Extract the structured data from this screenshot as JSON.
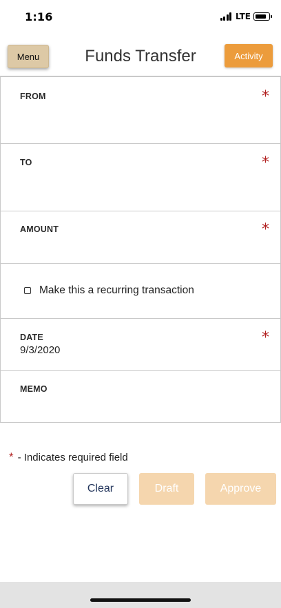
{
  "status_bar": {
    "time": "1:16",
    "network": "LTE",
    "icons": [
      "signal-icon",
      "battery-icon"
    ]
  },
  "header": {
    "menu_label": "Menu",
    "title": "Funds Transfer",
    "activity_label": "Activity",
    "colors": {
      "menu": "#ddc9a6",
      "activity": "#ec9c3c"
    }
  },
  "form": {
    "from": {
      "label": "FROM",
      "required_mark": "*",
      "value": ""
    },
    "to": {
      "label": "TO",
      "required_mark": "*",
      "value": ""
    },
    "amount": {
      "label": "AMOUNT",
      "required_mark": "*",
      "value": ""
    },
    "recurring": {
      "label": "Make this a recurring transaction",
      "checked": false
    },
    "date": {
      "label": "DATE",
      "required_mark": "*",
      "value": "9/3/2020"
    },
    "memo": {
      "label": "MEMO",
      "value": ""
    }
  },
  "note": {
    "star": "*",
    "text": "- Indicates required field"
  },
  "actions": {
    "clear_label": "Clear",
    "draft_label": "Draft",
    "approve_label": "Approve",
    "draft_enabled": false,
    "approve_enabled": false
  },
  "colors": {
    "required": "#b22222",
    "disabled_button": "#f5d6ae",
    "clear_text": "#23355c"
  }
}
